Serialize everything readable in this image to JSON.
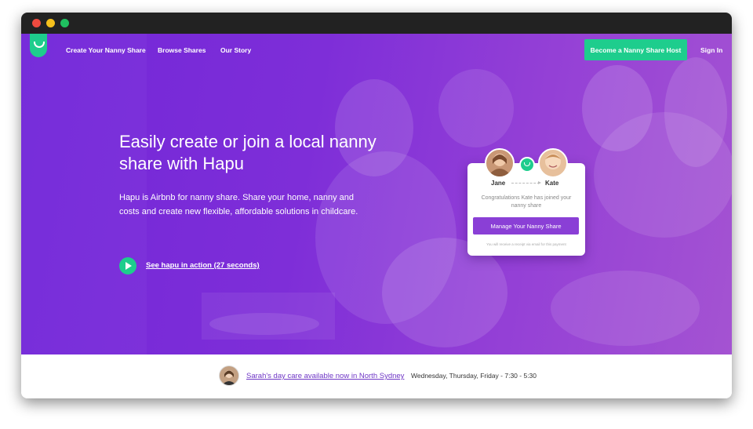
{
  "nav": {
    "links": [
      "Create Your Nanny Share",
      "Browse Shares",
      "Our Story"
    ],
    "host_button": "Become a Nanny Share Host",
    "signin": "Sign In"
  },
  "hero": {
    "headline": "Easily create or join a local nanny share with Hapu",
    "subtext": "Hapu is Airbnb for nanny share. Share your home, nanny and costs and create new flexible, affordable solutions in childcare.",
    "video_link": "See hapu in action (27 seconds)"
  },
  "card": {
    "left_name": "Jane",
    "right_name": "Kate",
    "message": "Congratulations Kate has joined your nanny share",
    "button": "Manage Your Nanny Share",
    "note": "You will receive a receipt via email for this payment"
  },
  "bottom": {
    "link": "Sarah's day care available now in North Sydney",
    "hours": "Wednesday, Thursday, Friday - 7:30 - 5:30"
  },
  "colors": {
    "purple": "#7227d9",
    "green": "#1ecd8d",
    "link_purple": "#6f36c6"
  },
  "icons": [
    "hapu-logo-icon",
    "play-icon",
    "arrow-icon"
  ]
}
